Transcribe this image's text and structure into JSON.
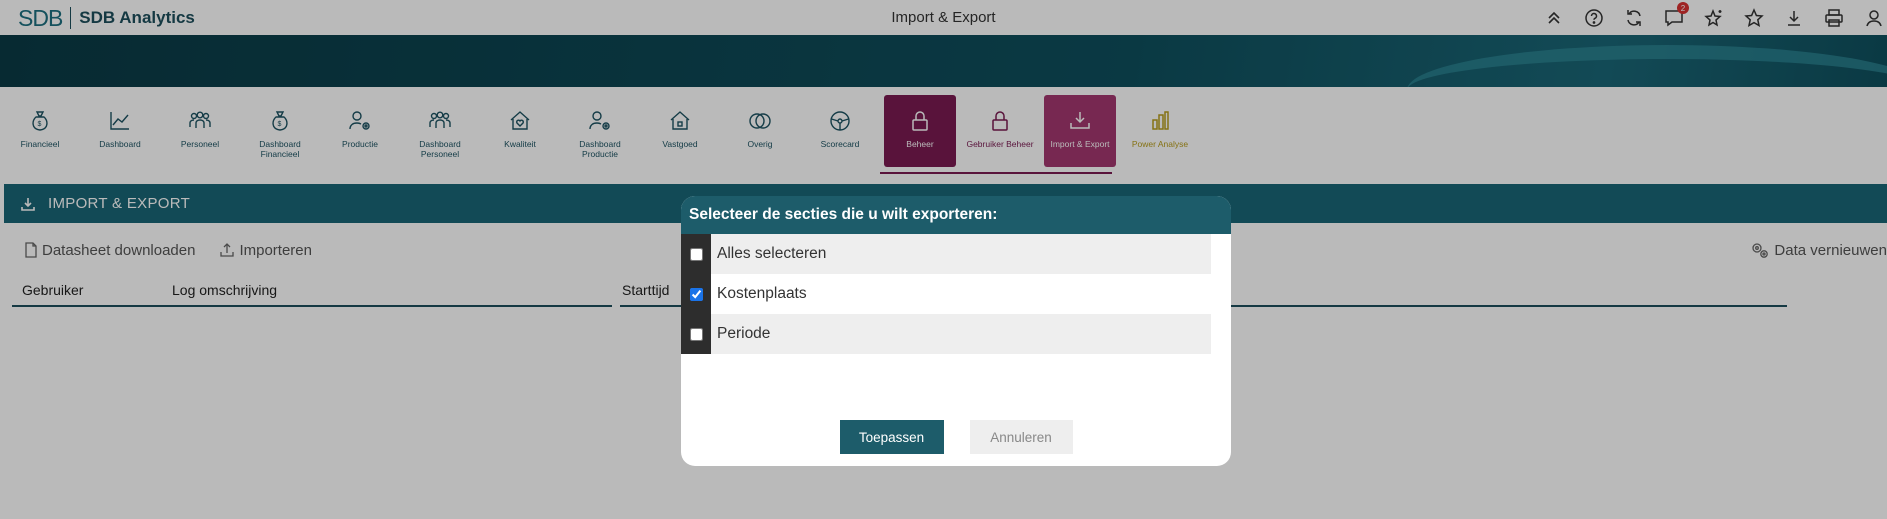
{
  "app": {
    "logo_mark": "SDB",
    "name": "SDB Analytics",
    "page_title": "Import & Export",
    "notification_count": "2"
  },
  "top_icons": [
    "chevrons-up-icon",
    "help-icon",
    "refresh-icon",
    "chat-icon",
    "sparkle-star-icon",
    "star-icon",
    "download-icon",
    "print-icon",
    "user-icon"
  ],
  "tiles": [
    {
      "label": "Financieel",
      "icon": "money-bag-icon"
    },
    {
      "label": "Dashboard",
      "icon": "line-chart-icon"
    },
    {
      "label": "Personeel",
      "icon": "people-icon"
    },
    {
      "label": "Dashboard Financieel",
      "icon": "money-bag-icon"
    },
    {
      "label": "Productie",
      "icon": "user-gear-icon"
    },
    {
      "label": "Dashboard Personeel",
      "icon": "people-icon"
    },
    {
      "label": "Kwaliteit",
      "icon": "house-heart-icon"
    },
    {
      "label": "Dashboard Productie",
      "icon": "user-gear-icon"
    },
    {
      "label": "Vastgoed",
      "icon": "house-icon"
    },
    {
      "label": "Overig",
      "icon": "circles-icon"
    },
    {
      "label": "Scorecard",
      "icon": "steering-icon"
    },
    {
      "label": "Beheer",
      "icon": "lock-icon"
    },
    {
      "label": "Gebruiker Beheer",
      "icon": "lock-icon"
    },
    {
      "label": "Import & Export",
      "icon": "tray-download-icon"
    },
    {
      "label": "Power Analyse",
      "icon": "bar-chart-icon"
    }
  ],
  "section": {
    "title": "IMPORT & EXPORT"
  },
  "toolbar": {
    "download_label": "Datasheet downloaden",
    "import_label": "Importeren",
    "refresh_label": "Data vernieuwen"
  },
  "table": {
    "headers": [
      "Gebruiker",
      "Log omschrijving",
      "Starttijd"
    ]
  },
  "modal": {
    "title": "Selecteer de secties die u wilt exporteren:",
    "options": [
      {
        "label": "Alles selecteren",
        "checked": false
      },
      {
        "label": "Kostenplaats",
        "checked": true
      },
      {
        "label": "Periode",
        "checked": false
      }
    ],
    "apply_label": "Toepassen",
    "cancel_label": "Annuleren"
  },
  "colors": {
    "primary": "#1d5c6a",
    "active_tile": "#7a1b52",
    "highlight_tile": "#a3386f",
    "gold": "#b79d1c"
  }
}
